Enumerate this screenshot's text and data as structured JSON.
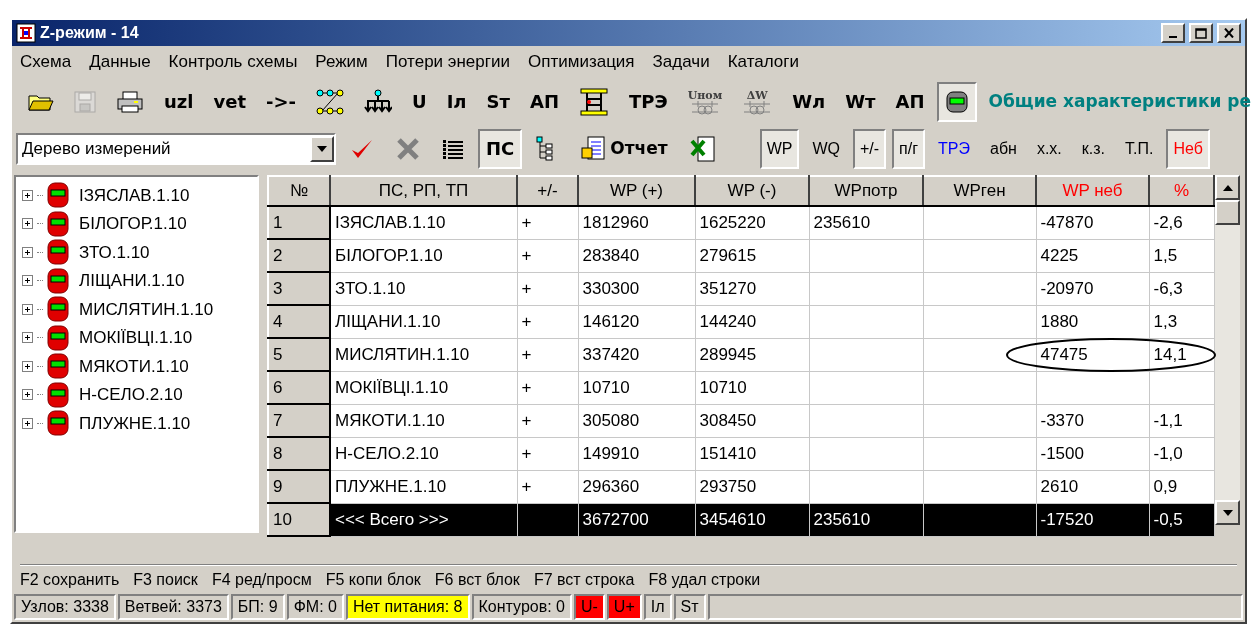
{
  "window": {
    "title": "Z-режим - 14"
  },
  "menu": [
    "Схема",
    "Данные",
    "Контроль схемы",
    "Режим",
    "Потери энергии",
    "Оптимизация",
    "Задачи",
    "Каталоги"
  ],
  "toolbar": [
    {
      "kind": "icon",
      "pressed": false,
      "disabled": false
    },
    {
      "kind": "icon",
      "pressed": false,
      "disabled": true
    },
    {
      "kind": "icon",
      "pressed": false,
      "disabled": false
    },
    {
      "kind": "text",
      "label": "uzl",
      "pressed": false,
      "disabled": false
    },
    {
      "kind": "text",
      "label": "vet",
      "pressed": false,
      "disabled": false
    },
    {
      "kind": "text",
      "label": "->-",
      "pressed": false,
      "disabled": false
    },
    {
      "kind": "icon",
      "pressed": false,
      "disabled": false
    },
    {
      "kind": "icon",
      "pressed": false,
      "disabled": false
    },
    {
      "kind": "text",
      "label": "U",
      "pressed": false,
      "disabled": false
    },
    {
      "kind": "text",
      "label": "Iл",
      "pressed": false,
      "disabled": false
    },
    {
      "kind": "text",
      "label": "Sт",
      "pressed": false,
      "disabled": false
    },
    {
      "kind": "text",
      "label": "АП",
      "pressed": false,
      "disabled": false
    },
    {
      "kind": "icon",
      "pressed": false,
      "disabled": false
    },
    {
      "kind": "text",
      "label": "ТРЭ",
      "pressed": false,
      "disabled": false
    },
    {
      "kind": "icon_text",
      "label": "Uном",
      "pressed": false,
      "disabled": false
    },
    {
      "kind": "icon_text",
      "label": "ΔW",
      "pressed": false,
      "disabled": false
    },
    {
      "kind": "text",
      "label": "Wл",
      "pressed": false,
      "disabled": false
    },
    {
      "kind": "text",
      "label": "Wт",
      "pressed": false,
      "disabled": false
    },
    {
      "kind": "text",
      "label": "АП",
      "pressed": false,
      "disabled": false
    },
    {
      "kind": "icon",
      "pressed": true,
      "disabled": false
    }
  ],
  "toolbar_caption": "Общие характеристики ре",
  "view_select": {
    "value": "Дерево измерений"
  },
  "toolbar2": [
    {
      "kind": "icon",
      "pressed": false
    },
    {
      "kind": "icon",
      "pressed": false
    },
    {
      "kind": "icon",
      "pressed": false
    },
    {
      "kind": "text",
      "label": "ПС",
      "pressed": true
    },
    {
      "kind": "icon",
      "pressed": false
    },
    {
      "kind": "icon_text",
      "label": "Отчет",
      "pressed": false
    },
    {
      "kind": "icon",
      "pressed": false
    }
  ],
  "toggles": [
    {
      "label": "WP",
      "selected": true,
      "color": "#000000"
    },
    {
      "label": "WQ",
      "selected": false,
      "color": "#000000"
    },
    {
      "label": "+/-",
      "selected": true,
      "color": "#000000"
    },
    {
      "label": "п/г",
      "selected": true,
      "color": "#000000"
    },
    {
      "label": "ТРЭ",
      "selected": false,
      "color": "#0000ff"
    },
    {
      "label": "абн",
      "selected": false,
      "color": "#000000"
    },
    {
      "label": "х.х.",
      "selected": false,
      "color": "#000000"
    },
    {
      "label": "к.з.",
      "selected": false,
      "color": "#000000"
    },
    {
      "label": "Т.П.",
      "selected": false,
      "color": "#000000"
    },
    {
      "label": "Неб",
      "selected": true,
      "color": "#ff0000"
    }
  ],
  "tree": {
    "items": [
      {
        "label": "ІЗЯСЛАВ.1.10",
        "expanded": false
      },
      {
        "label": "БІЛОГОР.1.10",
        "expanded": false
      },
      {
        "label": "ЗТО.1.10",
        "expanded": false
      },
      {
        "label": "ЛІЩАНИ.1.10",
        "expanded": false
      },
      {
        "label": "МИСЛЯТИН.1.10",
        "expanded": false
      },
      {
        "label": "МОКІЇВЦІ.1.10",
        "expanded": false
      },
      {
        "label": "МЯКОТИ.1.10",
        "expanded": false
      },
      {
        "label": "Н-СЕЛО.2.10",
        "expanded": false
      },
      {
        "label": "ПЛУЖНЕ.1.10",
        "expanded": false
      }
    ]
  },
  "table": {
    "columns": [
      {
        "label": "№",
        "color": "#000000"
      },
      {
        "label": "ПС, РП, ТП",
        "color": "#000000"
      },
      {
        "label": "+/-",
        "color": "#000000"
      },
      {
        "label": "WP (+)",
        "color": "#000000"
      },
      {
        "label": "WP (-)",
        "color": "#000000"
      },
      {
        "label": "WPпотр",
        "color": "#000000"
      },
      {
        "label": "WPген",
        "color": "#000000"
      },
      {
        "label": "WP неб",
        "color": "#ff0000"
      },
      {
        "label": "%",
        "color": "#ff0000"
      }
    ],
    "rows": [
      {
        "cells": [
          "1",
          "ІЗЯСЛАВ.1.10",
          "+",
          "1812960",
          "1625220",
          "235610",
          "",
          "-47870",
          "-2,6"
        ],
        "selected": false,
        "circled": false
      },
      {
        "cells": [
          "2",
          "БІЛОГОР.1.10",
          "+",
          "283840",
          "279615",
          "",
          "",
          "4225",
          "1,5"
        ],
        "selected": false,
        "circled": false
      },
      {
        "cells": [
          "3",
          "ЗТО.1.10",
          "+",
          "330300",
          "351270",
          "",
          "",
          "-20970",
          "-6,3"
        ],
        "selected": false,
        "circled": false
      },
      {
        "cells": [
          "4",
          "ЛІЩАНИ.1.10",
          "+",
          "146120",
          "144240",
          "",
          "",
          "1880",
          "1,3"
        ],
        "selected": false,
        "circled": false
      },
      {
        "cells": [
          "5",
          "МИСЛЯТИН.1.10",
          "+",
          "337420",
          "289945",
          "",
          "",
          "47475",
          "14,1"
        ],
        "selected": false,
        "circled": true
      },
      {
        "cells": [
          "6",
          "МОКІЇВЦІ.1.10",
          "+",
          "10710",
          "10710",
          "",
          "",
          "",
          ""
        ],
        "selected": false,
        "circled": false
      },
      {
        "cells": [
          "7",
          "МЯКОТИ.1.10",
          "+",
          "305080",
          "308450",
          "",
          "",
          "-3370",
          "-1,1"
        ],
        "selected": false,
        "circled": false
      },
      {
        "cells": [
          "8",
          "Н-СЕЛО.2.10",
          "+",
          "149910",
          "151410",
          "",
          "",
          "-1500",
          "-1,0"
        ],
        "selected": false,
        "circled": false
      },
      {
        "cells": [
          "9",
          "ПЛУЖНЕ.1.10",
          "+",
          "296360",
          "293750",
          "",
          "",
          "2610",
          "0,9"
        ],
        "selected": false,
        "circled": false
      },
      {
        "cells": [
          "10",
          "<<< Всего >>>",
          "",
          "3672700",
          "3454610",
          "235610",
          "",
          "-17520",
          "-0,5"
        ],
        "selected": true,
        "circled": false
      }
    ]
  },
  "function_keys": [
    "F2 сохранить",
    "F3 поиск",
    "F4 ред/просм",
    "F5 копи блок",
    "F6 вст блок",
    "F7 вст строка",
    "F8 удал строки"
  ],
  "status_bar": [
    {
      "text": "Узлов: 3338",
      "color": "#d4d0c8"
    },
    {
      "text": "Ветвей: 3373",
      "color": "#d4d0c8"
    },
    {
      "text": "БП: 9",
      "color": "#d4d0c8"
    },
    {
      "text": "ФМ: 0",
      "color": "#d4d0c8"
    },
    {
      "text": "Нет питания: 8",
      "color": "#ffff00"
    },
    {
      "text": "Контуров: 0",
      "color": "#d4d0c8"
    },
    {
      "text": "U-",
      "color": "#ff0000"
    },
    {
      "text": "U+",
      "color": "#ff0000"
    },
    {
      "text": "Iл",
      "color": "#d4d0c8"
    },
    {
      "text": "Sт",
      "color": "#d4d0c8"
    }
  ]
}
